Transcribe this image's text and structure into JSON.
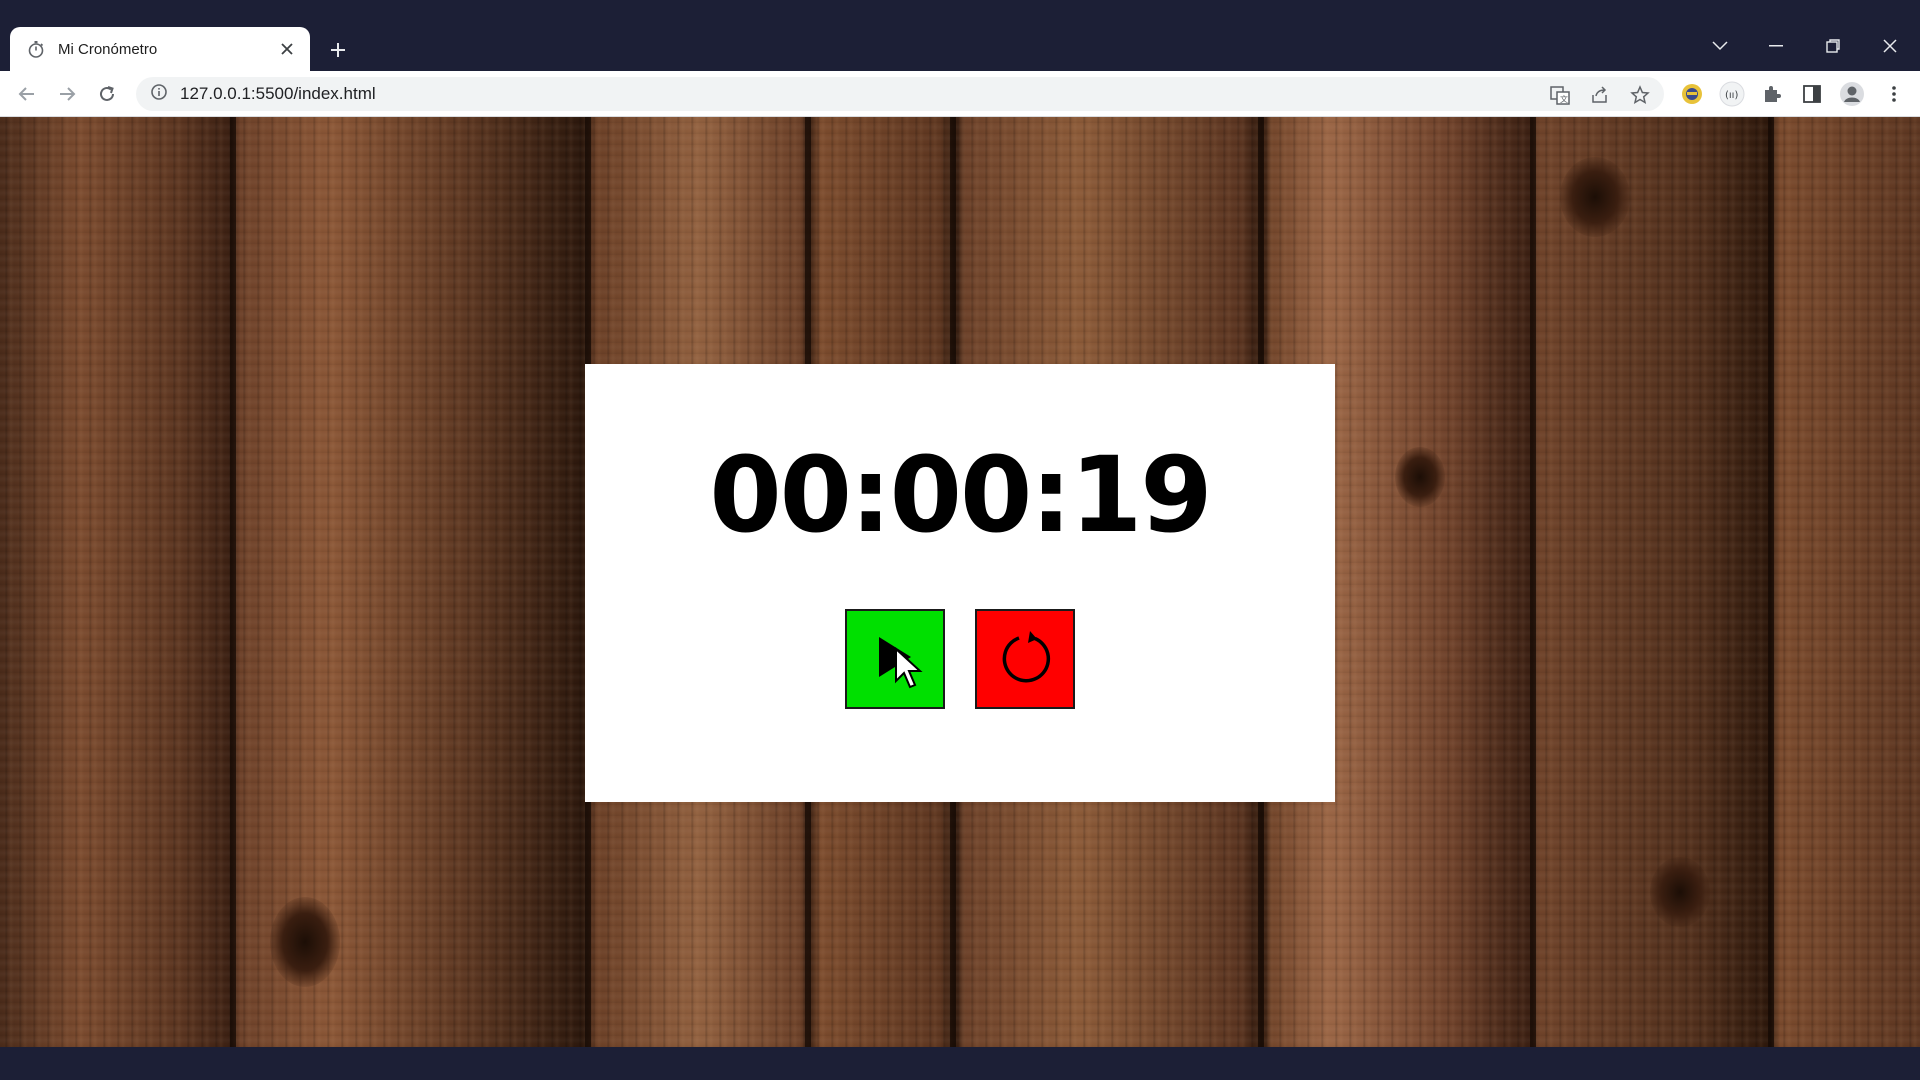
{
  "browser": {
    "tab": {
      "title": "Mi Cronómetro",
      "favicon": "stopwatch-icon"
    },
    "address": {
      "url": "127.0.0.1:5500/index.html",
      "security_icon": "info-icon"
    },
    "toolbar_icons": [
      "translate-icon",
      "share-icon",
      "bookmark-star-icon",
      "profile-extension-icon",
      "media-extension-icon",
      "extensions-puzzle-icon",
      "side-panel-icon",
      "account-icon",
      "menu-icon"
    ],
    "window_controls": [
      "tab-search-icon",
      "minimize-icon",
      "restore-icon",
      "close-icon"
    ]
  },
  "stopwatch": {
    "time": "00:00:19",
    "start_button": {
      "icon": "play-icon",
      "color": "#00e000"
    },
    "reset_button": {
      "icon": "reset-icon",
      "color": "#ff0000"
    }
  },
  "colors": {
    "chrome_frame": "#1c1f36",
    "card_background": "#ffffff"
  }
}
